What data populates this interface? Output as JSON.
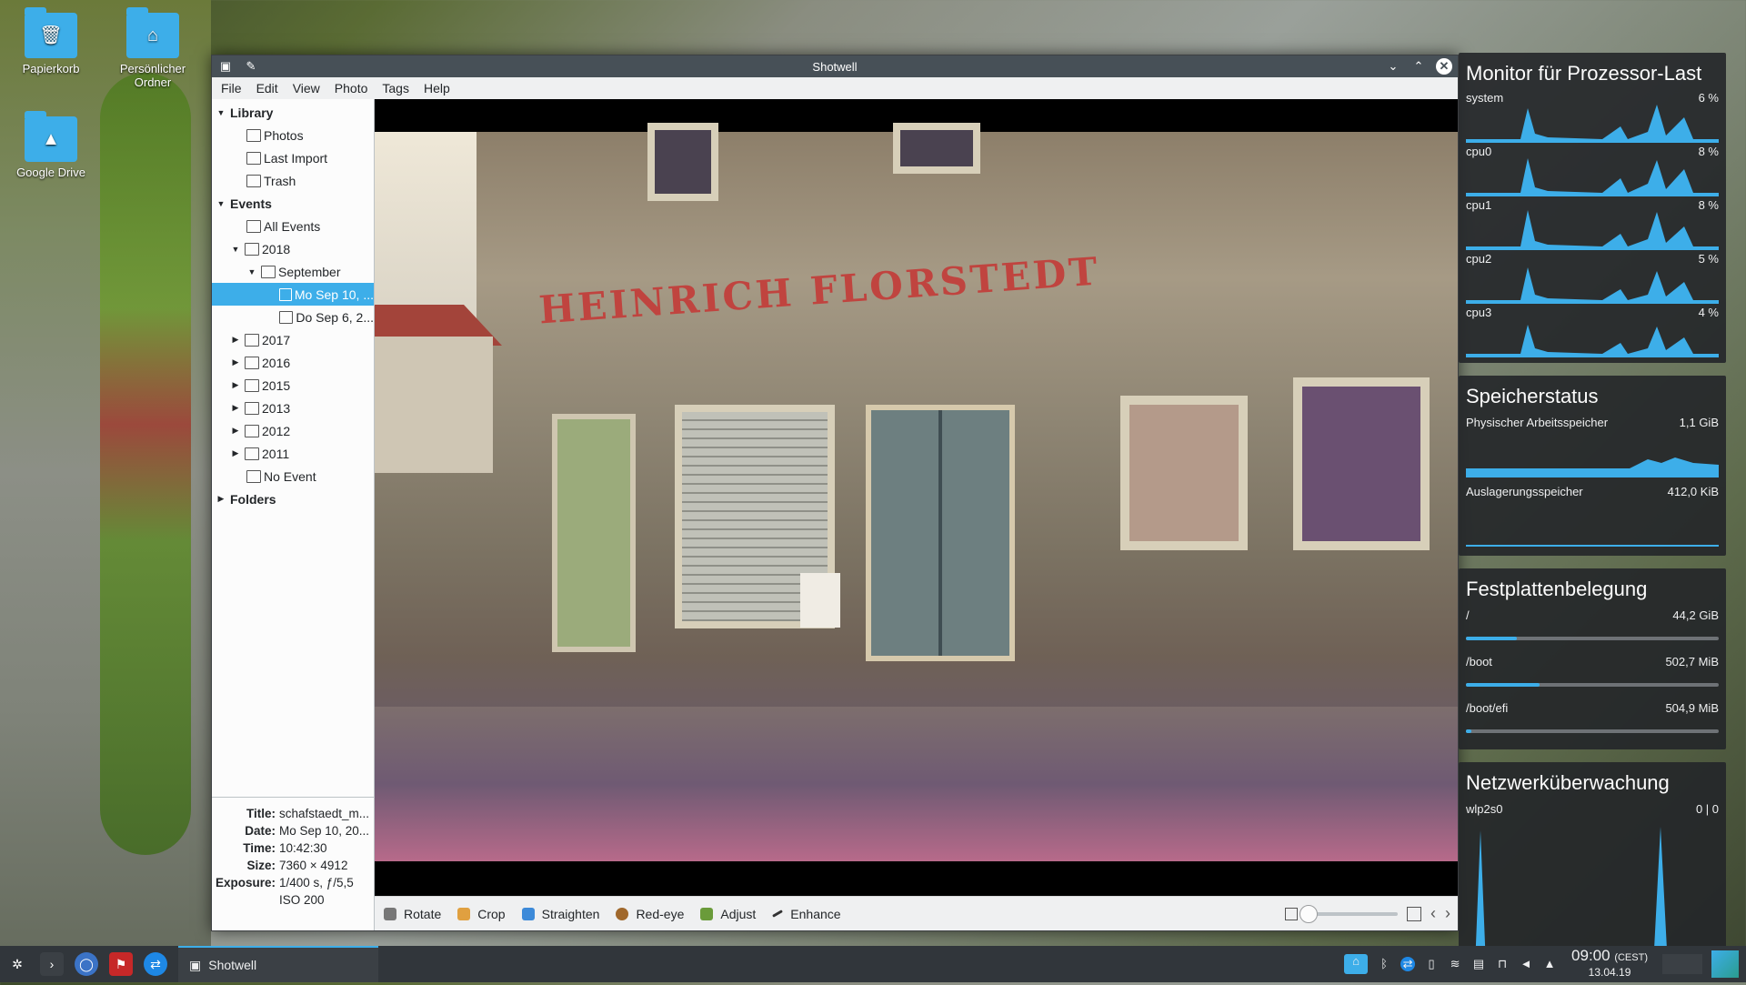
{
  "desktop": {
    "icons": [
      {
        "label": "Papierkorb"
      },
      {
        "label": "Persönlicher Ordner"
      },
      {
        "label": "Google Drive"
      }
    ]
  },
  "window": {
    "title": "Shotwell",
    "menu": [
      "File",
      "Edit",
      "View",
      "Photo",
      "Tags",
      "Help"
    ]
  },
  "sidebar": {
    "library": "Library",
    "photos": "Photos",
    "last_import": "Last Import",
    "trash": "Trash",
    "events": "Events",
    "all_events": "All Events",
    "y2018": "2018",
    "september": "September",
    "event_selected": "Mo Sep 10, ...",
    "event_2": "Do Sep 6, 2...",
    "years": [
      "2017",
      "2016",
      "2015",
      "2013",
      "2012",
      "2011"
    ],
    "no_event": "No Event",
    "folders": "Folders"
  },
  "metadata": {
    "title_key": "Title:",
    "title_val": "schafstaedt_m...",
    "date_key": "Date:",
    "date_val": "Mo Sep 10, 20...",
    "time_key": "Time:",
    "time_val": "10:42:30",
    "size_key": "Size:",
    "size_val": "7360 × 4912",
    "exposure_key": "Exposure:",
    "exposure_val": "1/400 s, ƒ/5,5",
    "iso_val": "ISO 200"
  },
  "photo": {
    "sign_text": "HEINRICH FLORSTEDT"
  },
  "toolbar": {
    "rotate": "Rotate",
    "crop": "Crop",
    "straighten": "Straighten",
    "redeye": "Red-eye",
    "adjust": "Adjust",
    "enhance": "Enhance",
    "zoom_level": 0.0
  },
  "widgets": {
    "cpu": {
      "title": "Monitor für Prozessor-Last",
      "rows": [
        {
          "label": "system",
          "value": "6 %"
        },
        {
          "label": "cpu0",
          "value": "8 %"
        },
        {
          "label": "cpu1",
          "value": "8 %"
        },
        {
          "label": "cpu2",
          "value": "5 %"
        },
        {
          "label": "cpu3",
          "value": "4 %"
        }
      ]
    },
    "memory": {
      "title": "Speicherstatus",
      "physical_label": "Physischer Arbeitsspeicher",
      "physical_value": "1,1 GiB",
      "swap_label": "Auslagerungsspeicher",
      "swap_value": "412,0 KiB"
    },
    "disk": {
      "title": "Festplattenbelegung",
      "rows": [
        {
          "label": "/",
          "value": "44,2 GiB",
          "fill": 0.2
        },
        {
          "label": "/boot",
          "value": "502,7 MiB",
          "fill": 0.29
        },
        {
          "label": "/boot/efi",
          "value": "504,9 MiB",
          "fill": 0.02
        }
      ]
    },
    "network": {
      "title": "Netzwerküberwachung",
      "iface": "wlp2s0",
      "value": "0 | 0"
    }
  },
  "taskbar": {
    "task_label": "Shotwell",
    "time": "09:00",
    "tz": "(CEST)",
    "date": "13.04.19"
  },
  "colors": {
    "accent": "#3daee9",
    "panel_bg": "#232629",
    "titlebar": "#475057"
  }
}
